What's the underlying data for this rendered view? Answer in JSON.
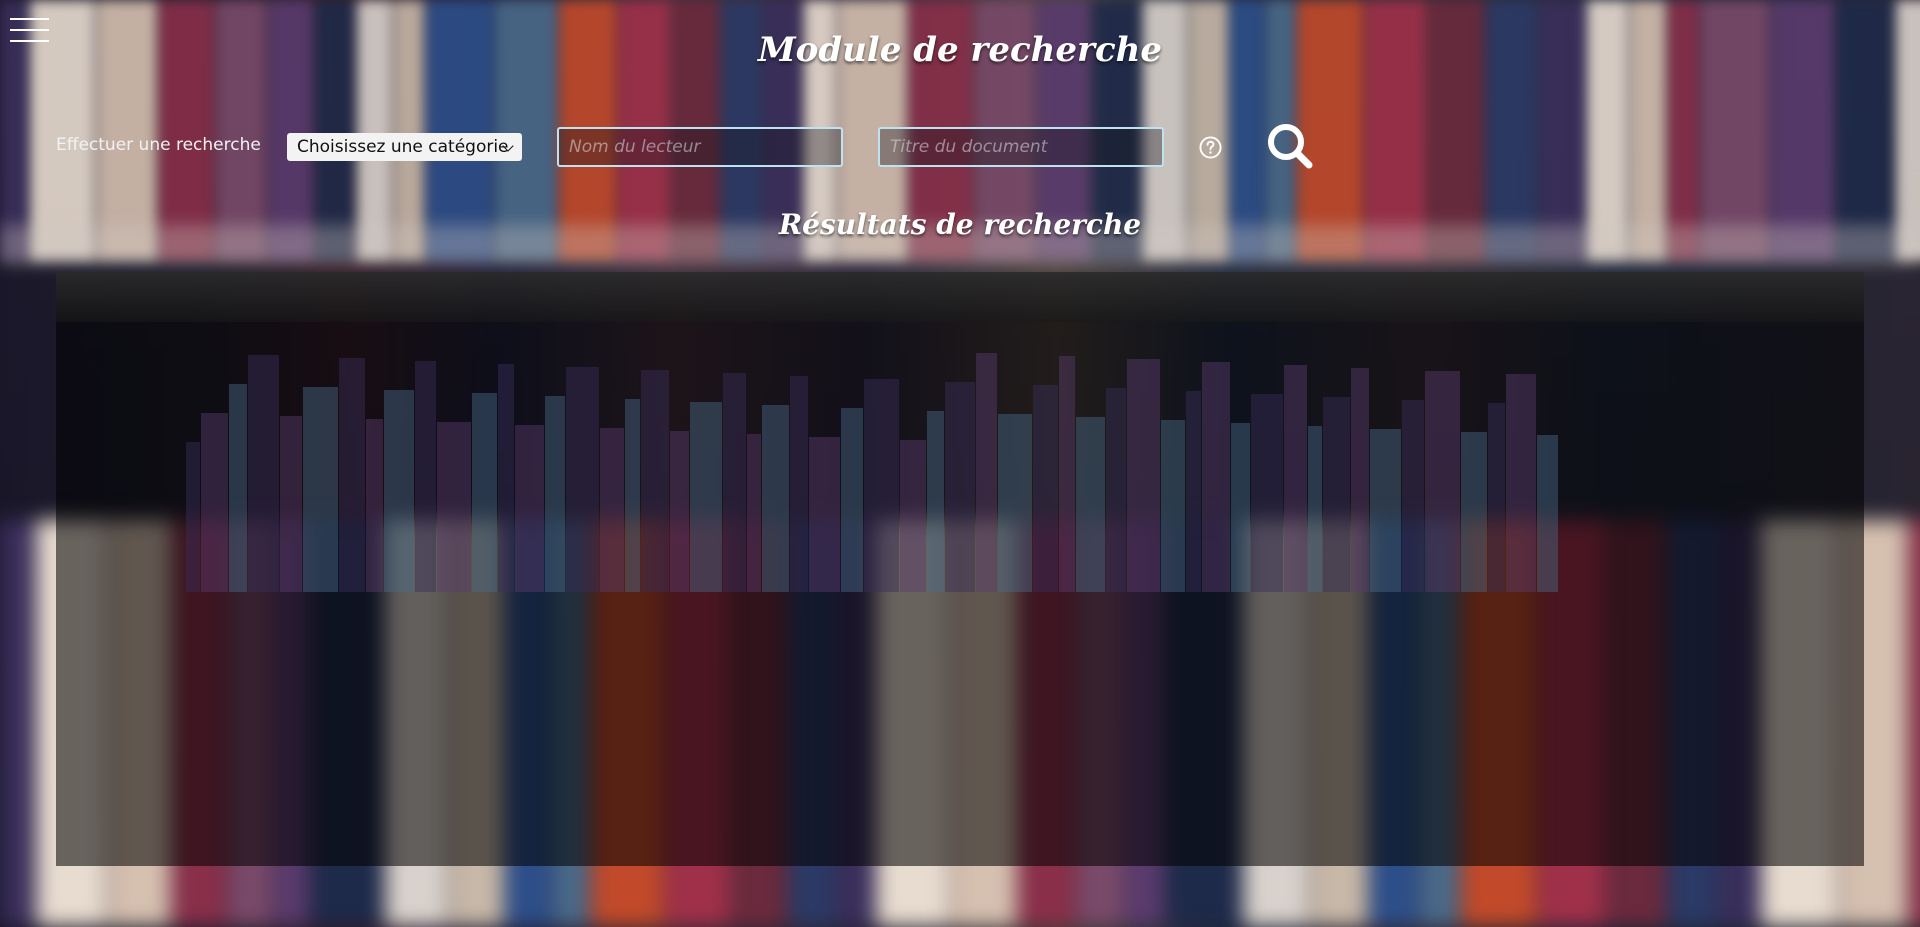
{
  "header": {
    "title": "Module de recherche"
  },
  "search": {
    "label": "Effectuer une recherche",
    "category": {
      "selected": "Choisissez une catégorie"
    },
    "reader": {
      "placeholder": "Nom du lecteur",
      "value": ""
    },
    "document": {
      "placeholder": "Titre du document",
      "value": ""
    },
    "help_icon": "question-circle-icon",
    "submit_icon": "search-icon"
  },
  "results": {
    "title": "Résultats de recherche"
  },
  "menu_icon": "hamburger-menu-icon"
}
